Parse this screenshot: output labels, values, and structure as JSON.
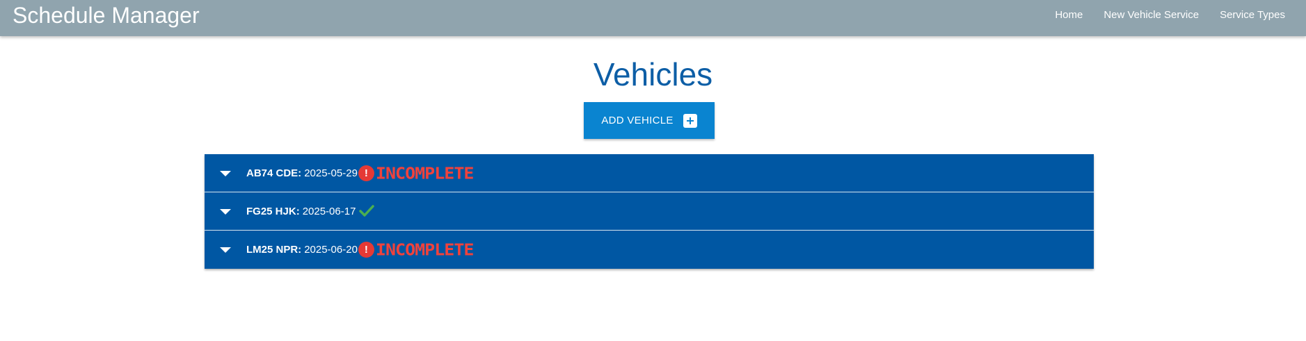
{
  "header": {
    "brand": "Schedule Manager",
    "nav": [
      "Home",
      "New Vehicle Service",
      "Service Types"
    ]
  },
  "main": {
    "title": "Vehicles",
    "add_button_label": "ADD VEHICLE"
  },
  "vehicles": [
    {
      "registration": "AB74 CDE:",
      "date": "2025-05-29",
      "status": "incomplete",
      "status_label": "INCOMPLETE",
      "alert_glyph": "!"
    },
    {
      "registration": "FG25 HJK:",
      "date": "2025-06-17",
      "status": "complete"
    },
    {
      "registration": "LM25 NPR:",
      "date": "2025-06-20",
      "status": "incomplete",
      "status_label": "INCOMPLETE",
      "alert_glyph": "!"
    }
  ],
  "colors": {
    "navbar": "#90a4ae",
    "title": "#0d5ea6",
    "button": "#0a84d0",
    "row": "#0057a3",
    "alert": "#e53935",
    "check": "#4caf50"
  },
  "icons": {
    "add_button": "plus-icon",
    "row_toggle": "caret-down-icon",
    "incomplete": "exclamation-icon",
    "complete": "check-icon"
  }
}
